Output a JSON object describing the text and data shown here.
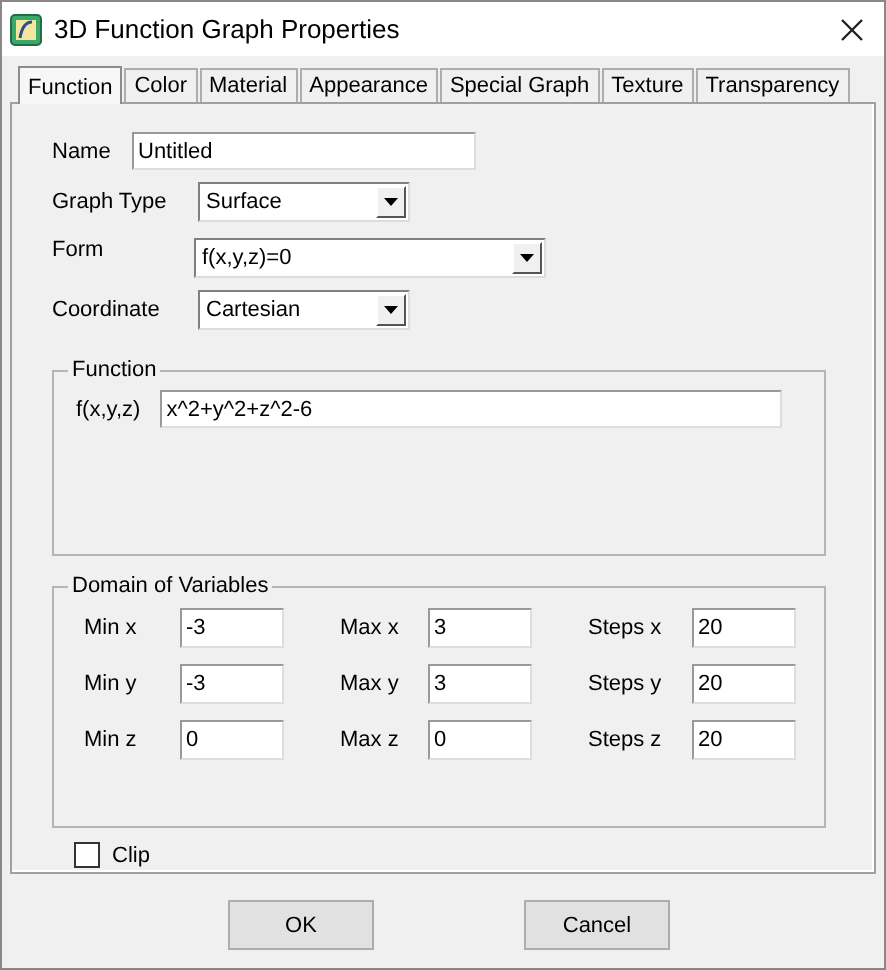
{
  "window": {
    "title": "3D Function Graph Properties"
  },
  "tabs": [
    {
      "label": "Function",
      "selected": true
    },
    {
      "label": "Color",
      "selected": false
    },
    {
      "label": "Material",
      "selected": false
    },
    {
      "label": "Appearance",
      "selected": false
    },
    {
      "label": "Special Graph",
      "selected": false
    },
    {
      "label": "Texture",
      "selected": false
    },
    {
      "label": "Transparency",
      "selected": false
    }
  ],
  "fields": [
    {
      "kind": "text",
      "label": "Name",
      "value": "Untitled"
    },
    {
      "kind": "dropdown",
      "label": "Graph Type",
      "value": "Surface"
    },
    {
      "kind": "dropdown",
      "label": "Form",
      "value": "f(x,y,z)=0"
    },
    {
      "kind": "dropdown",
      "label": "Coordinate",
      "value": "Cartesian"
    }
  ],
  "function_group": {
    "title": "Function",
    "label": "f(x,y,z)",
    "value": "x^2+y^2+z^2-6"
  },
  "domain_group": {
    "title": "Domain of Variables",
    "rows": [
      [
        {
          "label": "Min x",
          "value": "-3"
        },
        {
          "label": "Max x",
          "value": "3"
        },
        {
          "label": "Steps x",
          "value": "20"
        }
      ],
      [
        {
          "label": "Min y",
          "value": "-3"
        },
        {
          "label": "Max y",
          "value": "3"
        },
        {
          "label": "Steps y",
          "value": "20"
        }
      ],
      [
        {
          "label": "Min z",
          "value": "0"
        },
        {
          "label": "Max z",
          "value": "0"
        },
        {
          "label": "Steps z",
          "value": "20"
        }
      ]
    ]
  },
  "clip": {
    "label": "Clip",
    "checked": false
  },
  "buttons": [
    "OK",
    "Cancel"
  ]
}
